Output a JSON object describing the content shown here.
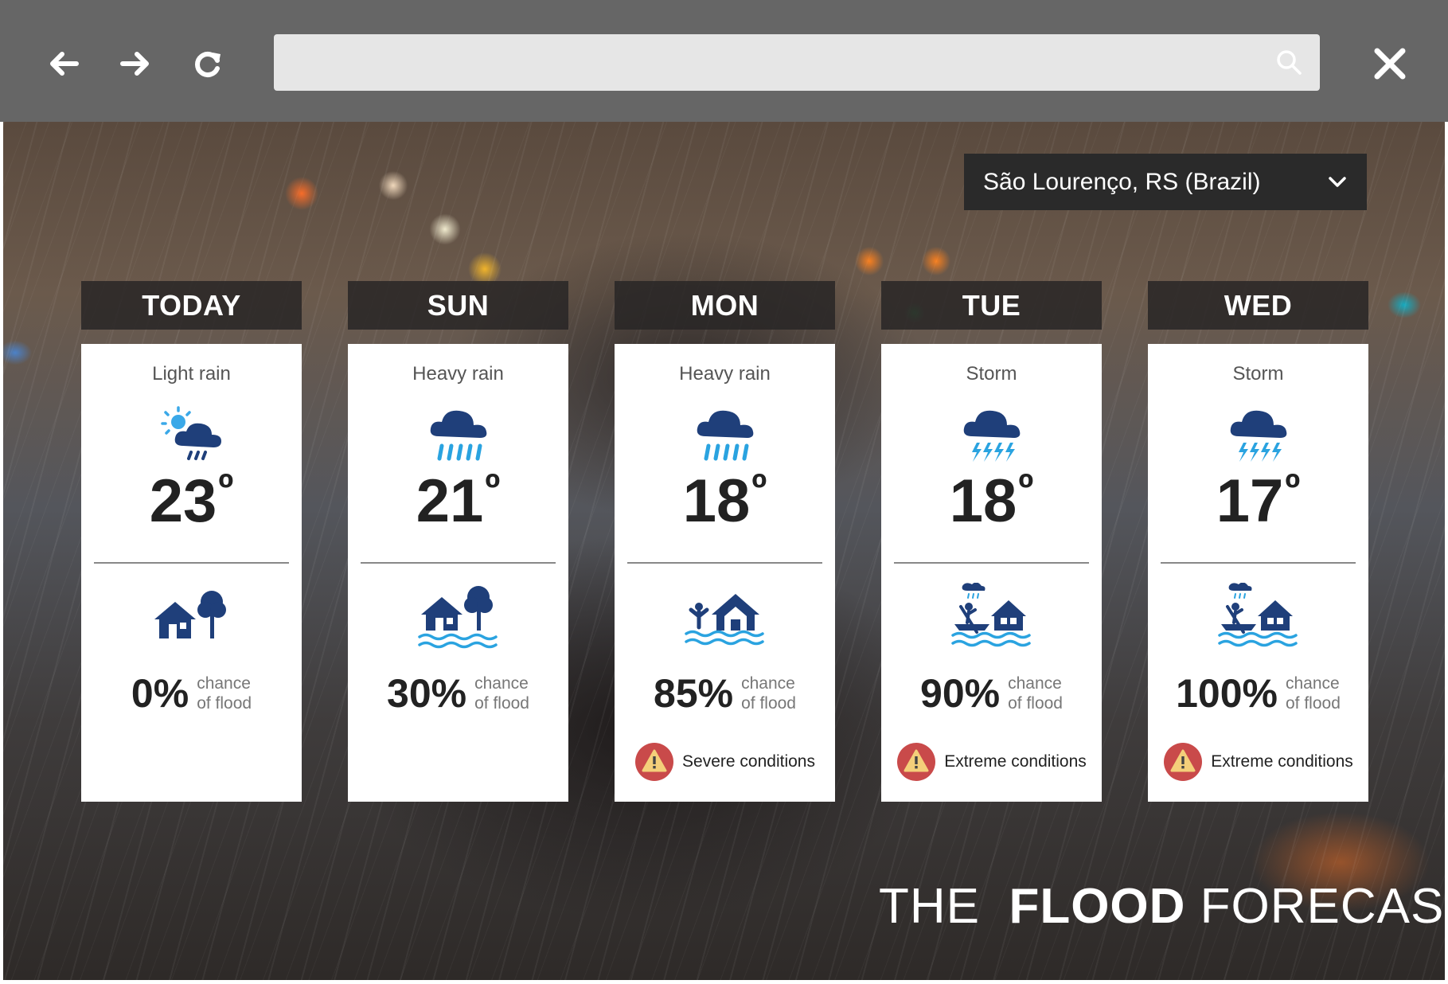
{
  "browser": {
    "url_value": "",
    "icons": [
      "back-arrow-icon",
      "forward-arrow-icon",
      "refresh-icon",
      "search-icon",
      "close-icon"
    ]
  },
  "location": {
    "selected": "São Lourenço, RS (Brazil)"
  },
  "days": [
    {
      "day": "TODAY",
      "condition": "Light rain",
      "temp": "23",
      "deg": "º",
      "weather_icon": "sun-cloud-rain-icon",
      "flood_icon": "house-tree-icon",
      "chance_value": "0%",
      "chance_line1": "chance",
      "chance_line2": "of flood",
      "alert": ""
    },
    {
      "day": "SUN",
      "condition": "Heavy rain",
      "temp": "21",
      "deg": "º",
      "weather_icon": "cloud-rain-icon",
      "flood_icon": "house-tree-water-icon",
      "chance_value": "30%",
      "chance_line1": "chance",
      "chance_line2": "of flood",
      "alert": ""
    },
    {
      "day": "MON",
      "condition": "Heavy rain",
      "temp": "18",
      "deg": "º",
      "weather_icon": "cloud-rain-icon",
      "flood_icon": "flooded-house-person-icon",
      "chance_value": "85%",
      "chance_line1": "chance",
      "chance_line2": "of flood",
      "alert": "Severe conditions"
    },
    {
      "day": "TUE",
      "condition": "Storm",
      "temp": "18",
      "deg": "º",
      "weather_icon": "cloud-storm-icon",
      "flood_icon": "flood-boat-house-icon",
      "chance_value": "90%",
      "chance_line1": "chance",
      "chance_line2": "of flood",
      "alert": "Extreme conditions"
    },
    {
      "day": "WED",
      "condition": "Storm",
      "temp": "17",
      "deg": "º",
      "weather_icon": "cloud-storm-icon",
      "flood_icon": "flood-boat-house-icon",
      "chance_value": "100%",
      "chance_line1": "chance",
      "chance_line2": "of flood",
      "alert": "Extreme conditions"
    }
  ],
  "brand": {
    "the": "THE",
    "flood": "FLOOD",
    "forecast": "FORECAST"
  },
  "colors": {
    "chrome": "#666666",
    "icon_navy": "#1f3f7a",
    "icon_blue": "#2aa3e0",
    "sun_blue": "#3aa8e8",
    "alert_red": "#c94a4a",
    "alert_yellow": "#f4cf7a"
  }
}
